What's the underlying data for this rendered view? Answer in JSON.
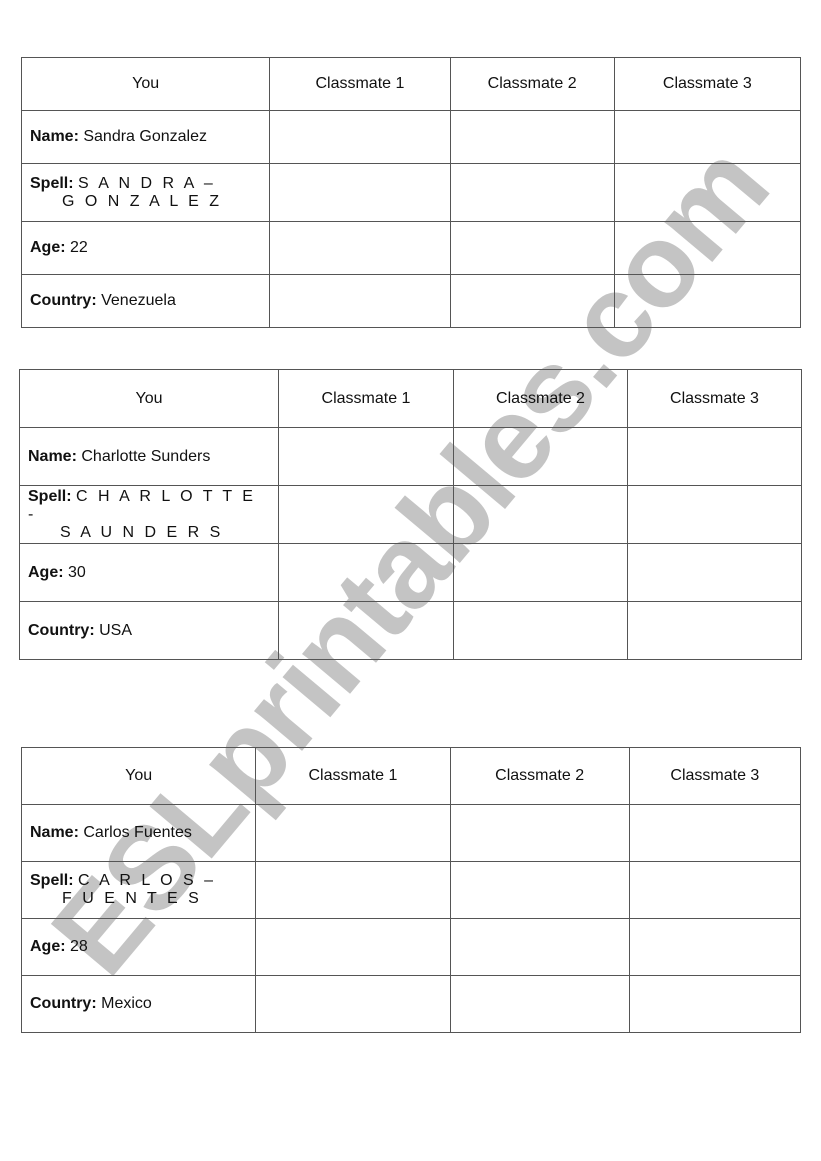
{
  "watermark": "ESLprintables.com",
  "headers": [
    "You",
    "Classmate 1",
    "Classmate 2",
    "Classmate 3"
  ],
  "labels": {
    "name": "Name:",
    "spell": "Spell:",
    "age": "Age:",
    "country": "Country:"
  },
  "tables": [
    {
      "name": "Sandra Gonzalez",
      "spell_line1": "S A N D R A –",
      "spell_line2": "G O N Z A L E Z",
      "age": "22",
      "country": "Venezuela"
    },
    {
      "name": "Charlotte Sunders",
      "spell_line1": "C H A R L O T T E -",
      "spell_line2": "S A U N D E R S",
      "age": "30",
      "country": "USA"
    },
    {
      "name": "Carlos Fuentes",
      "spell_line1": "C A R L O S –",
      "spell_line2": "F U E N T E S",
      "age": "28",
      "country": "Mexico"
    }
  ]
}
